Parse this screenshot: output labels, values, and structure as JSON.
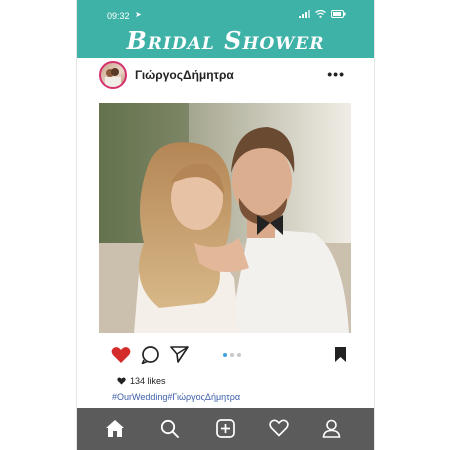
{
  "status_bar": {
    "time": "09:32"
  },
  "header": {
    "title": "Bridal Shower",
    "background": "#3fb2a7"
  },
  "post": {
    "username": "ΓιώργοςΔήμητρα",
    "likes": "134 likes",
    "hashtags": "#OurWedding#ΓιώργοςΔήμητρα",
    "carousel": {
      "count": 3,
      "active_index": 1
    }
  },
  "icons": {
    "more": "more-options-icon",
    "like": "heart-icon",
    "comment": "comment-icon",
    "share": "share-icon",
    "save": "bookmark-icon",
    "nav": [
      "home-icon",
      "search-icon",
      "add-post-icon",
      "activity-icon",
      "profile-icon"
    ]
  },
  "colors": {
    "like": "#d42b2b",
    "hashtag": "#3b5ea8",
    "nav_bar": "#5b5b5b",
    "accent_dot": "#3fa0e0"
  }
}
